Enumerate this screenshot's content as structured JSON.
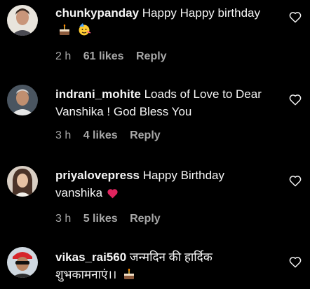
{
  "comments": [
    {
      "username": "chunkypanday",
      "text": "Happy Happy birthday",
      "emojis": [
        "cake-emoji",
        "partying-face-emoji"
      ],
      "time": "2 h",
      "likes": "61 likes",
      "reply": "Reply"
    },
    {
      "username": "indrani_mohite",
      "text": "Loads of Love to Dear Vanshika ! God Bless You",
      "emojis": [],
      "time": "3 h",
      "likes": "4 likes",
      "reply": "Reply"
    },
    {
      "username": "priyalovepress",
      "text": "Happy Birthday vanshika",
      "emojis": [
        "red-heart-emoji"
      ],
      "time": "3 h",
      "likes": "5 likes",
      "reply": "Reply"
    },
    {
      "username": "vikas_rai560",
      "text": "जन्मदिन की हार्दिक शुभकामनाएं।।",
      "emojis": [
        "cake-emoji"
      ],
      "time": "",
      "likes": "",
      "reply": ""
    }
  ],
  "colors": {
    "background": "#000000",
    "text": "#f5f5f5",
    "meta": "#a8a8a8",
    "heart_emoji": "#e0245e"
  },
  "icons": {
    "like": "heart-outline-icon"
  }
}
